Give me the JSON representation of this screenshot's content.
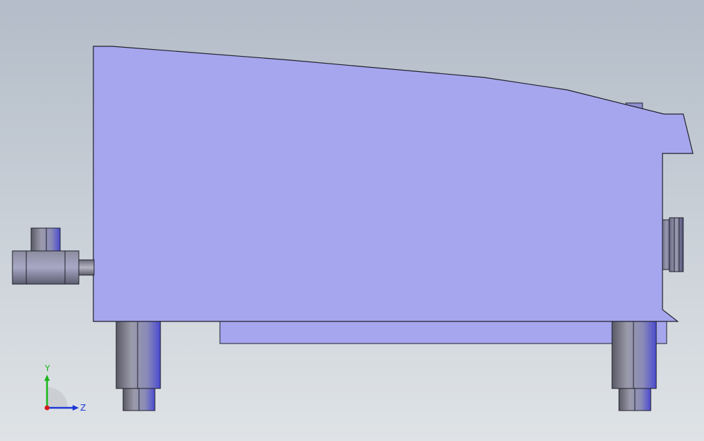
{
  "viewport": {
    "background_top": "#b3bcc8",
    "background_bottom": "#dfe3e6",
    "part_color": "#a6a6ee",
    "edge_color": "#1f1f2a"
  },
  "triad": {
    "y_label": "Y",
    "z_label": "Z",
    "y_color": "#19b519",
    "z_color": "#1a37d6",
    "x_color": "#d61a1a"
  }
}
